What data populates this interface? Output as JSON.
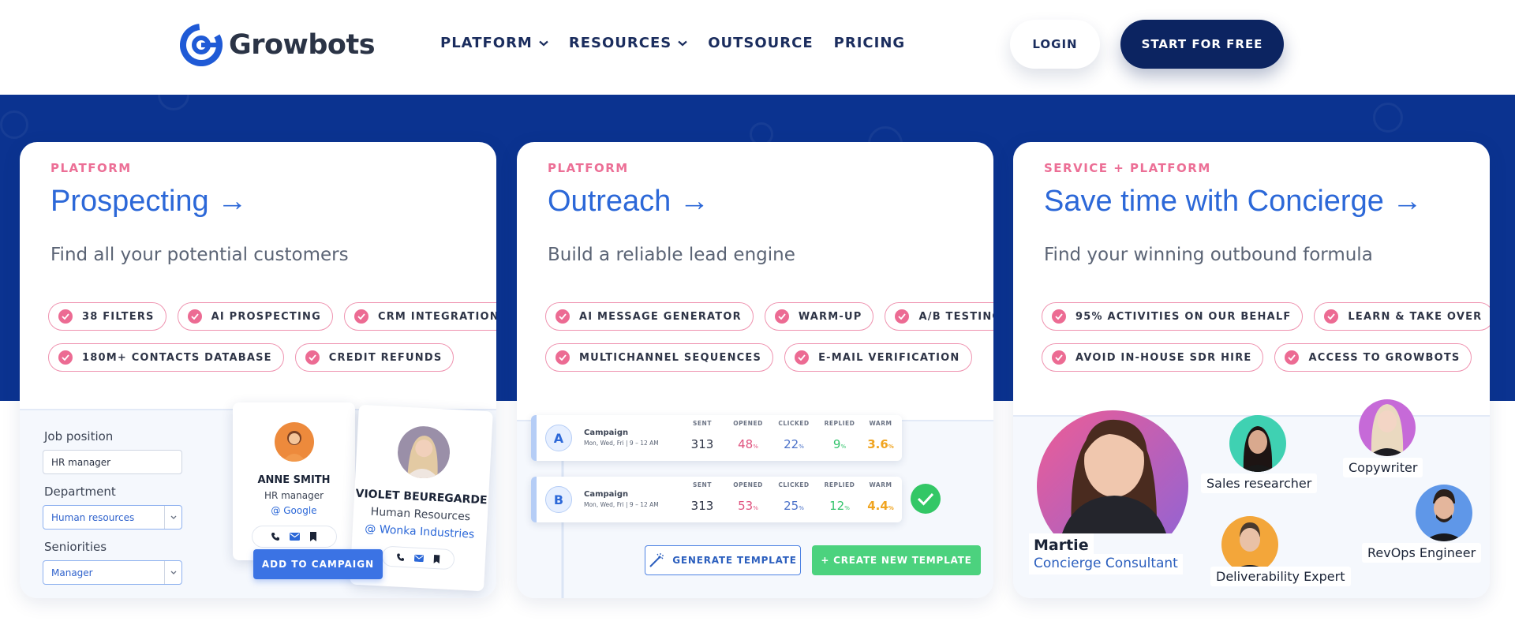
{
  "header": {
    "brand": "Growbots",
    "nav": [
      {
        "label": "PLATFORM",
        "has_dropdown": true
      },
      {
        "label": "RESOURCES",
        "has_dropdown": true
      },
      {
        "label": "OUTSOURCE",
        "has_dropdown": false
      },
      {
        "label": "PRICING",
        "has_dropdown": false
      }
    ],
    "login_label": "LOGIN",
    "start_label": "START FOR FREE"
  },
  "colors": {
    "brand_blue": "#1f5ad6",
    "band": "#0b3390",
    "navy": "#0c2461",
    "accent_pink": "#ec6f96",
    "title_blue": "#2c68d8",
    "green": "#4cd27e"
  },
  "cards": {
    "prospecting": {
      "eyebrow": "PLATFORM",
      "title": "Prospecting →",
      "subtitle": "Find all your potential customers",
      "chips_row1": [
        "38 FILTERS",
        "AI PROSPECTING",
        "CRM INTEGRATIONS"
      ],
      "chips_row2": [
        "180M+ CONTACTS DATABASE",
        "CREDIT REFUNDS"
      ],
      "form": {
        "job_label": "Job position",
        "job_value": "HR manager",
        "dept_label": "Department",
        "dept_value": "Human resources",
        "sen_label": "Seniorities",
        "sen_value": "Manager"
      },
      "person1": {
        "name": "ANNE SMITH",
        "role": "HR manager",
        "company": "@ Google"
      },
      "person2": {
        "name": "VIOLET BEUREGARDE",
        "role": "Human Resources",
        "company": "@ Wonka Industries"
      },
      "add_label": "ADD TO CAMPAIGN"
    },
    "outreach": {
      "eyebrow": "PLATFORM",
      "title": "Outreach →",
      "subtitle": "Build a reliable lead engine",
      "chips_row1": [
        "AI MESSAGE GENERATOR",
        "WARM-UP",
        "A/B TESTING"
      ],
      "chips_row2": [
        "MULTICHANNEL SEQUENCES",
        "E-MAIL VERIFICATION"
      ],
      "stat_headers": [
        "SENT",
        "OPENED",
        "CLICKED",
        "REPLIED",
        "WARM"
      ],
      "campaigns": [
        {
          "letter": "A",
          "name": "Campaign",
          "schedule": "Mon, Wed, Fri | 9 – 12 AM",
          "sent": "313",
          "opened": "48",
          "clicked": "22",
          "replied": "9",
          "warm": "3.6",
          "unit": "%"
        },
        {
          "letter": "B",
          "name": "Campaign",
          "schedule": "Mon, Wed, Fri | 9 – 12 AM",
          "sent": "313",
          "opened": "53",
          "clicked": "25",
          "replied": "12",
          "warm": "4.4",
          "unit": "%"
        }
      ],
      "generate_label": "GENERATE TEMPLATE",
      "create_label": "+ CREATE NEW TEMPLATE"
    },
    "concierge": {
      "eyebrow": "SERVICE + PLATFORM",
      "title": "Save time with Concierge →",
      "subtitle": "Find your winning outbound formula",
      "chips_row1": [
        "95% ACTIVITIES ON OUR BEHALF",
        "LEARN & TAKE OVER"
      ],
      "chips_row2": [
        "AVOID IN-HOUSE SDR HIRE",
        "ACCESS TO GROWBOTS"
      ],
      "martie_name": "Martie",
      "martie_role": "Concierge Consultant",
      "roles": [
        "Sales researcher",
        "Copywriter",
        "RevOps Engineer",
        "Deliverability Expert"
      ]
    }
  }
}
